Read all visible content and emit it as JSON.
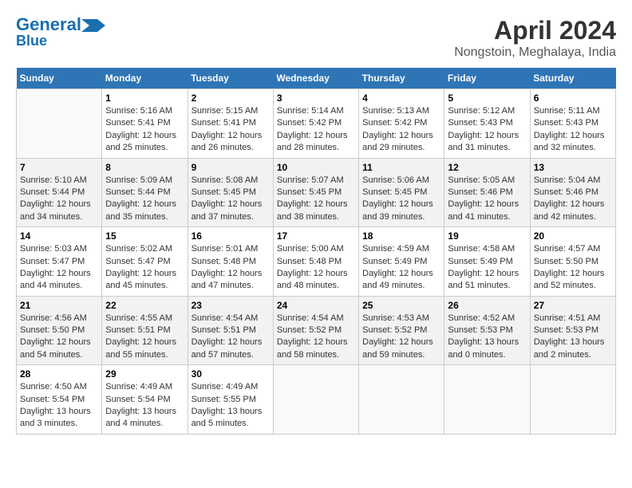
{
  "header": {
    "logo_line1": "General",
    "logo_line2": "Blue",
    "title": "April 2024",
    "subtitle": "Nongstoin, Meghalaya, India"
  },
  "days_of_week": [
    "Sunday",
    "Monday",
    "Tuesday",
    "Wednesday",
    "Thursday",
    "Friday",
    "Saturday"
  ],
  "weeks": [
    [
      {
        "day": "",
        "info": ""
      },
      {
        "day": "1",
        "info": "Sunrise: 5:16 AM\nSunset: 5:41 PM\nDaylight: 12 hours\nand 25 minutes."
      },
      {
        "day": "2",
        "info": "Sunrise: 5:15 AM\nSunset: 5:41 PM\nDaylight: 12 hours\nand 26 minutes."
      },
      {
        "day": "3",
        "info": "Sunrise: 5:14 AM\nSunset: 5:42 PM\nDaylight: 12 hours\nand 28 minutes."
      },
      {
        "day": "4",
        "info": "Sunrise: 5:13 AM\nSunset: 5:42 PM\nDaylight: 12 hours\nand 29 minutes."
      },
      {
        "day": "5",
        "info": "Sunrise: 5:12 AM\nSunset: 5:43 PM\nDaylight: 12 hours\nand 31 minutes."
      },
      {
        "day": "6",
        "info": "Sunrise: 5:11 AM\nSunset: 5:43 PM\nDaylight: 12 hours\nand 32 minutes."
      }
    ],
    [
      {
        "day": "7",
        "info": "Sunrise: 5:10 AM\nSunset: 5:44 PM\nDaylight: 12 hours\nand 34 minutes."
      },
      {
        "day": "8",
        "info": "Sunrise: 5:09 AM\nSunset: 5:44 PM\nDaylight: 12 hours\nand 35 minutes."
      },
      {
        "day": "9",
        "info": "Sunrise: 5:08 AM\nSunset: 5:45 PM\nDaylight: 12 hours\nand 37 minutes."
      },
      {
        "day": "10",
        "info": "Sunrise: 5:07 AM\nSunset: 5:45 PM\nDaylight: 12 hours\nand 38 minutes."
      },
      {
        "day": "11",
        "info": "Sunrise: 5:06 AM\nSunset: 5:45 PM\nDaylight: 12 hours\nand 39 minutes."
      },
      {
        "day": "12",
        "info": "Sunrise: 5:05 AM\nSunset: 5:46 PM\nDaylight: 12 hours\nand 41 minutes."
      },
      {
        "day": "13",
        "info": "Sunrise: 5:04 AM\nSunset: 5:46 PM\nDaylight: 12 hours\nand 42 minutes."
      }
    ],
    [
      {
        "day": "14",
        "info": "Sunrise: 5:03 AM\nSunset: 5:47 PM\nDaylight: 12 hours\nand 44 minutes."
      },
      {
        "day": "15",
        "info": "Sunrise: 5:02 AM\nSunset: 5:47 PM\nDaylight: 12 hours\nand 45 minutes."
      },
      {
        "day": "16",
        "info": "Sunrise: 5:01 AM\nSunset: 5:48 PM\nDaylight: 12 hours\nand 47 minutes."
      },
      {
        "day": "17",
        "info": "Sunrise: 5:00 AM\nSunset: 5:48 PM\nDaylight: 12 hours\nand 48 minutes."
      },
      {
        "day": "18",
        "info": "Sunrise: 4:59 AM\nSunset: 5:49 PM\nDaylight: 12 hours\nand 49 minutes."
      },
      {
        "day": "19",
        "info": "Sunrise: 4:58 AM\nSunset: 5:49 PM\nDaylight: 12 hours\nand 51 minutes."
      },
      {
        "day": "20",
        "info": "Sunrise: 4:57 AM\nSunset: 5:50 PM\nDaylight: 12 hours\nand 52 minutes."
      }
    ],
    [
      {
        "day": "21",
        "info": "Sunrise: 4:56 AM\nSunset: 5:50 PM\nDaylight: 12 hours\nand 54 minutes."
      },
      {
        "day": "22",
        "info": "Sunrise: 4:55 AM\nSunset: 5:51 PM\nDaylight: 12 hours\nand 55 minutes."
      },
      {
        "day": "23",
        "info": "Sunrise: 4:54 AM\nSunset: 5:51 PM\nDaylight: 12 hours\nand 57 minutes."
      },
      {
        "day": "24",
        "info": "Sunrise: 4:54 AM\nSunset: 5:52 PM\nDaylight: 12 hours\nand 58 minutes."
      },
      {
        "day": "25",
        "info": "Sunrise: 4:53 AM\nSunset: 5:52 PM\nDaylight: 12 hours\nand 59 minutes."
      },
      {
        "day": "26",
        "info": "Sunrise: 4:52 AM\nSunset: 5:53 PM\nDaylight: 13 hours\nand 0 minutes."
      },
      {
        "day": "27",
        "info": "Sunrise: 4:51 AM\nSunset: 5:53 PM\nDaylight: 13 hours\nand 2 minutes."
      }
    ],
    [
      {
        "day": "28",
        "info": "Sunrise: 4:50 AM\nSunset: 5:54 PM\nDaylight: 13 hours\nand 3 minutes."
      },
      {
        "day": "29",
        "info": "Sunrise: 4:49 AM\nSunset: 5:54 PM\nDaylight: 13 hours\nand 4 minutes."
      },
      {
        "day": "30",
        "info": "Sunrise: 4:49 AM\nSunset: 5:55 PM\nDaylight: 13 hours\nand 5 minutes."
      },
      {
        "day": "",
        "info": ""
      },
      {
        "day": "",
        "info": ""
      },
      {
        "day": "",
        "info": ""
      },
      {
        "day": "",
        "info": ""
      }
    ]
  ]
}
